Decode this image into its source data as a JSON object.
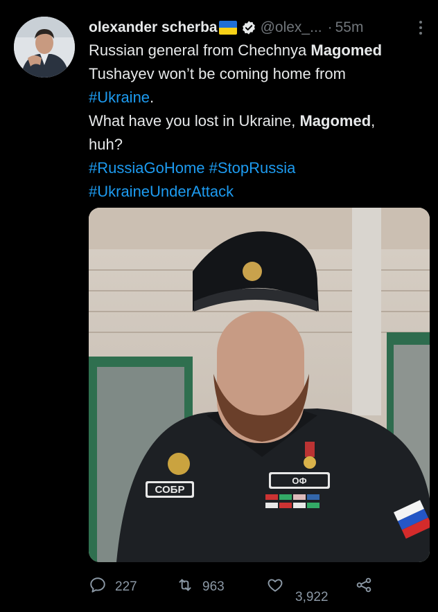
{
  "tweet": {
    "author": {
      "name": "olexander scherba",
      "flag": "ukraine-flag-icon",
      "verified": "verified-badge-icon",
      "handle": "@olex_...",
      "separator": "·",
      "time": "55m"
    },
    "text": {
      "l1a": "Russian general from Chechnya ",
      "l1b": "Magomed",
      "l2": "Tushayev won’t be coming home from",
      "l3a": "#Ukraine",
      "l3b": ".",
      "l4a": "What have you lost in Ukraine, ",
      "l4b": "Magomed",
      "l4c": ",",
      "l5": "huh?",
      "l6a": "#RussiaGoHome",
      "l6b": " ",
      "l6c": "#StopRussia",
      "l7": "#UkraineUnderAttack"
    },
    "media": {
      "badge_left": "СОБР",
      "badge_right": "ОФ"
    },
    "actions": {
      "replies": "227",
      "retweets": "963",
      "likes": "3,922"
    }
  },
  "colors": {
    "background": "#000000",
    "text": "#e7e9ea",
    "muted": "#71767b",
    "link": "#1d9bf0",
    "verified": "#e7e9ea"
  }
}
